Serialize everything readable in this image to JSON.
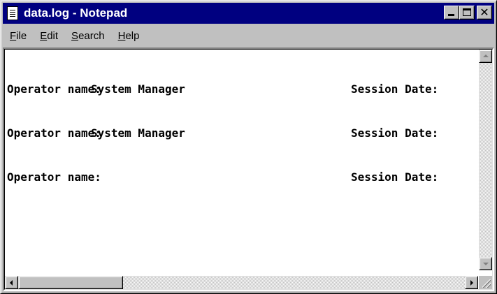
{
  "window": {
    "title": "data.log - Notepad",
    "titlebar_color": "#000080",
    "frame_color": "#c0c0c0"
  },
  "titlebar": {
    "app_icon": "notepad-icon",
    "buttons": [
      "minimize-icon",
      "maximize-icon",
      "close-icon"
    ],
    "close_glyph": "✕"
  },
  "menubar": {
    "items": [
      {
        "accel": "F",
        "rest": "ile"
      },
      {
        "accel": "E",
        "rest": "dit"
      },
      {
        "accel": "S",
        "rest": "earch"
      },
      {
        "accel": "H",
        "rest": "elp"
      }
    ]
  },
  "document": {
    "lines": [
      {
        "label": "Operator name:",
        "value": "System Manager",
        "session": "Session Date:"
      },
      {
        "label": "Operator name:",
        "value": "System Manager",
        "session": "Session Date:"
      },
      {
        "label": "Operator name:",
        "value": "",
        "session": "Session Date:"
      }
    ]
  },
  "scrollbars": {
    "vertical": {
      "up": "scroll-up-arrow-icon",
      "down": "scroll-down-arrow-icon"
    },
    "horizontal": {
      "left": "scroll-left-arrow-icon",
      "right": "scroll-right-arrow-icon"
    }
  }
}
